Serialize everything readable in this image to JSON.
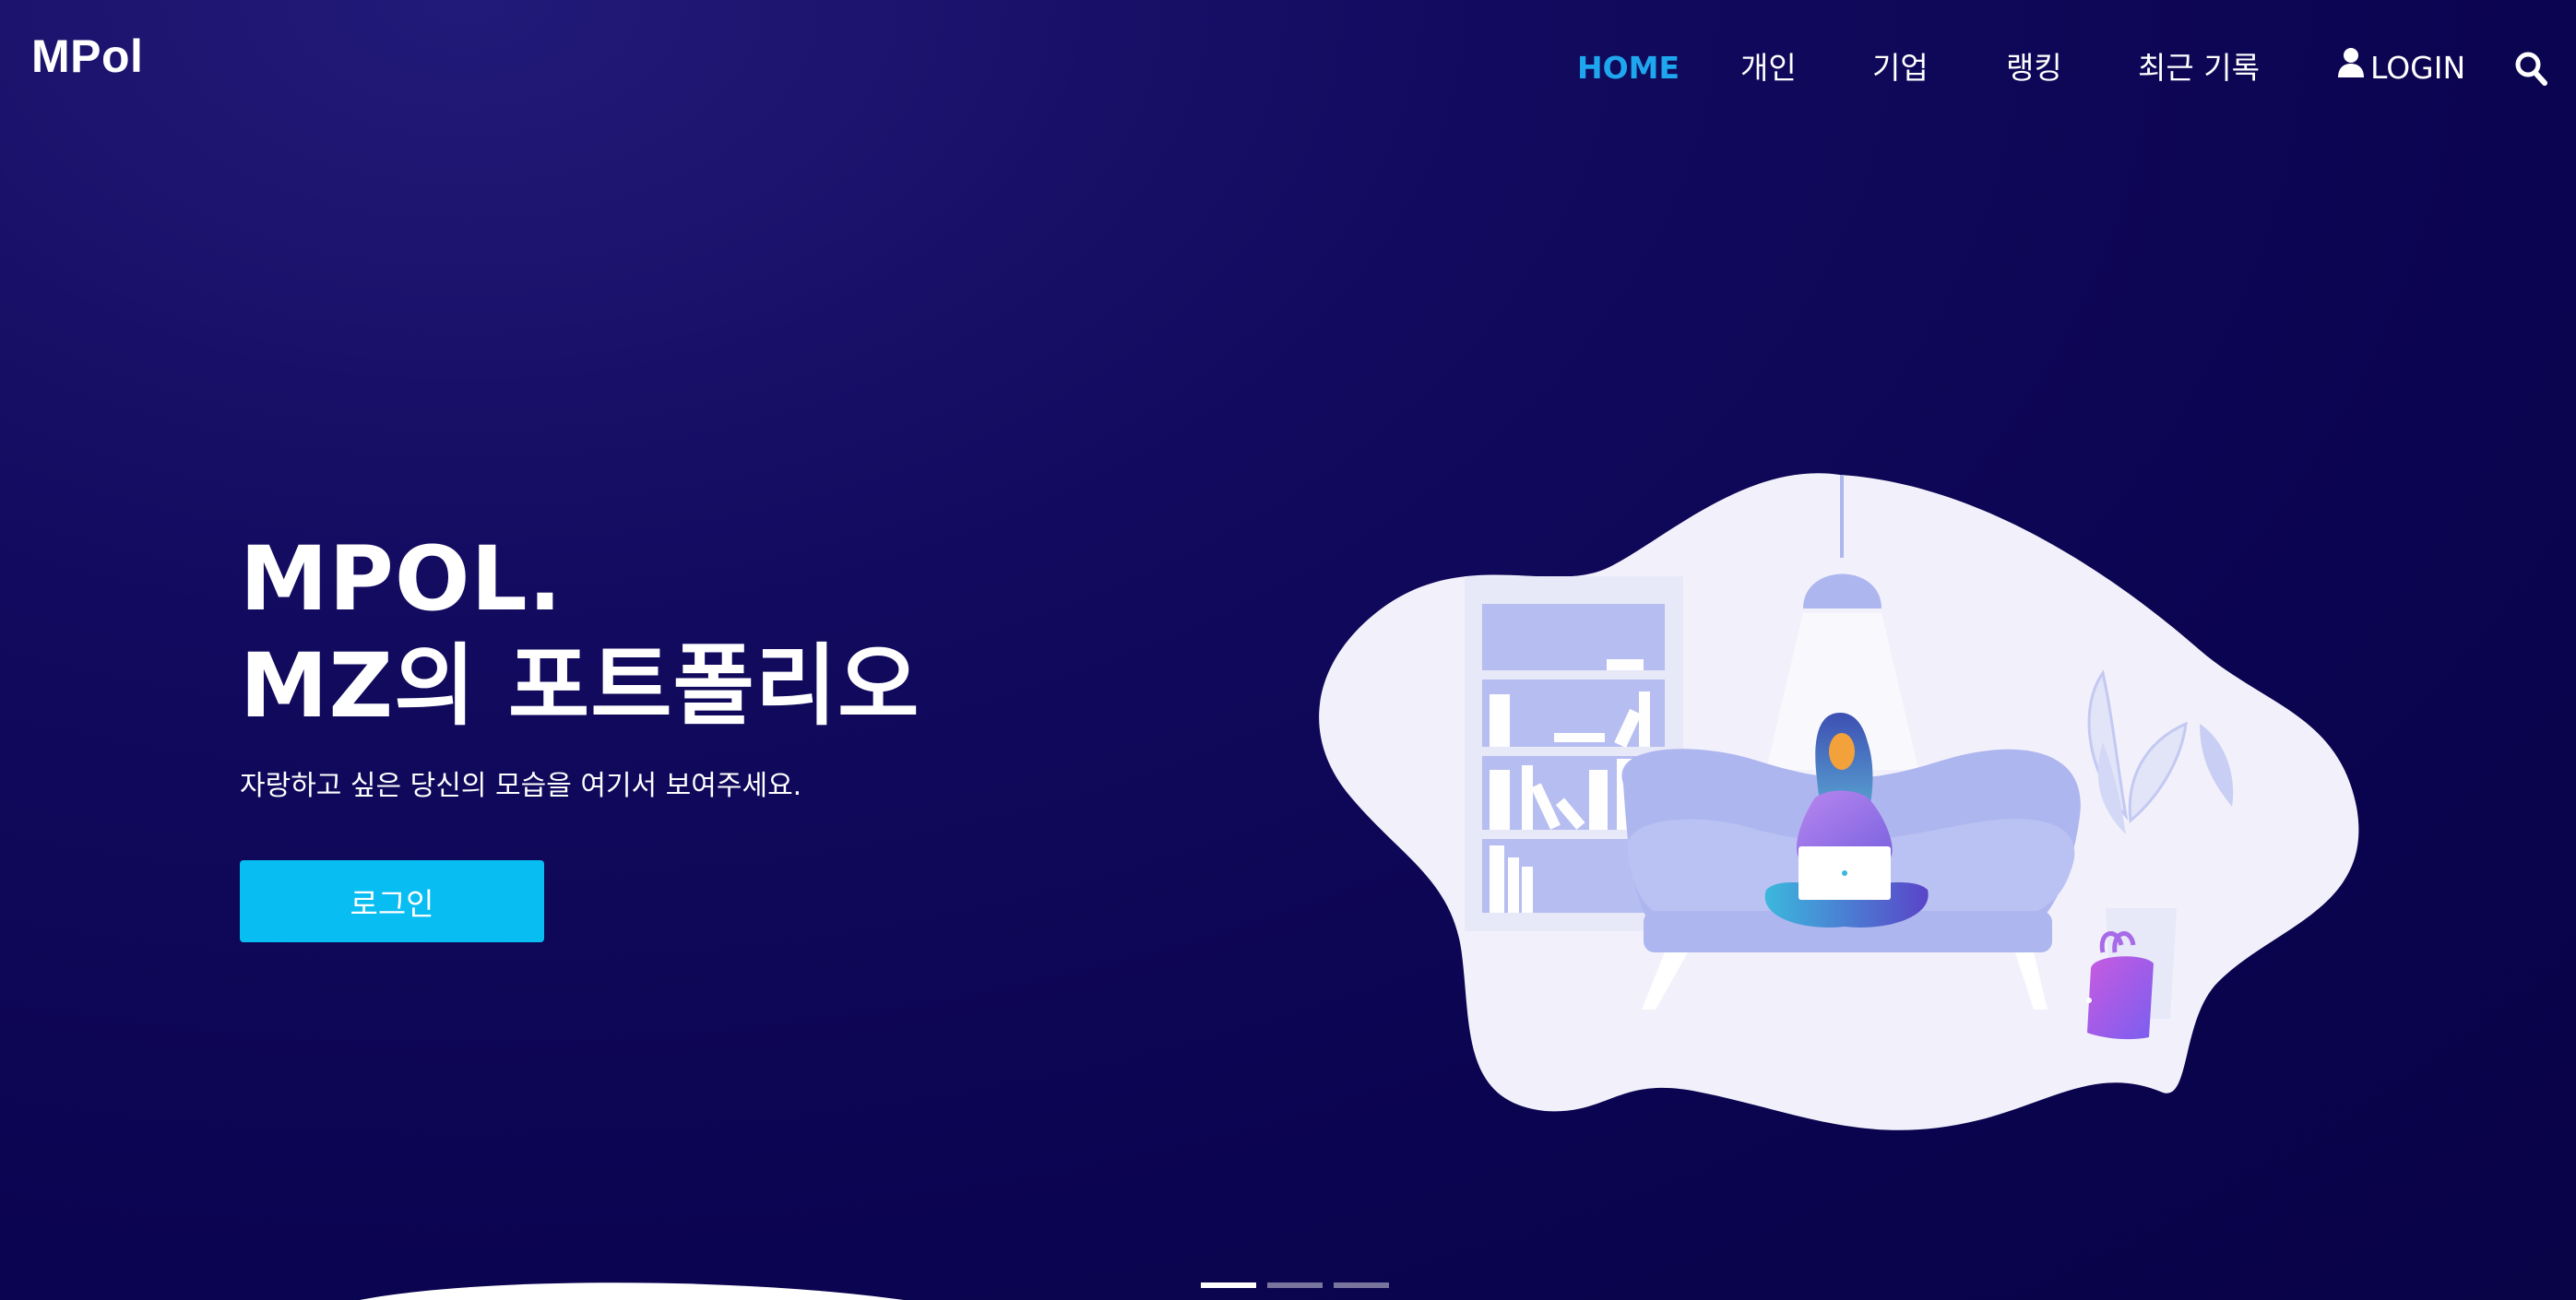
{
  "brand": {
    "logo": "MPol"
  },
  "nav": {
    "items": [
      {
        "label": "HOME",
        "active": true
      },
      {
        "label": "개인"
      },
      {
        "label": "기업"
      },
      {
        "label": "랭킹"
      },
      {
        "label": "최근 기록"
      }
    ],
    "login_label": "LOGIN",
    "icons": {
      "login": "user-icon",
      "search": "search-icon"
    }
  },
  "hero": {
    "title_line1": "MPOL.",
    "title_line2": "MZ의 포트폴리오",
    "subtitle": "자랑하고 싶은 당신의 모습을 여기서 보여주세요.",
    "cta_label": "로그인"
  },
  "slider": {
    "count": 3,
    "active_index": 0
  },
  "colors": {
    "background": "#0b0450",
    "accent": "#1ea7ee",
    "cta": "#07bdf2",
    "illustration_bg": "#f2f1fb",
    "illustration_accent": "#aeb6ef"
  }
}
